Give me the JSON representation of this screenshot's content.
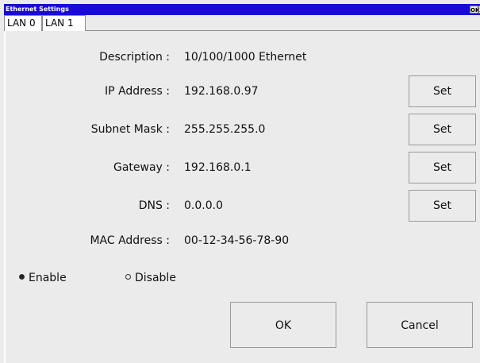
{
  "window": {
    "title": "Ethernet Settings",
    "ok_label": "OK",
    "close_label": "X"
  },
  "tabs": [
    {
      "label": "LAN 0",
      "selected": true
    },
    {
      "label": "LAN 1",
      "selected": false
    }
  ],
  "fields": {
    "description": {
      "label": "Description :",
      "value": "10/100/1000 Ethernet"
    },
    "ip": {
      "label": "IP Address :",
      "value": "192.168.0.97",
      "button": "Set"
    },
    "subnet": {
      "label": "Subnet Mask :",
      "value": "255.255.255.0",
      "button": "Set"
    },
    "gateway": {
      "label": "Gateway :",
      "value": "192.168.0.1",
      "button": "Set"
    },
    "dns": {
      "label": "DNS :",
      "value": "0.0.0.0",
      "button": "Set"
    },
    "mac": {
      "label": "MAC Address :",
      "value": "00-12-34-56-78-90"
    }
  },
  "mode": {
    "enable_label": "Enable",
    "disable_label": "Disable",
    "selected": "Enable"
  },
  "actions": {
    "ok_label": "OK",
    "cancel_label": "Cancel"
  },
  "colors": {
    "titlebar": "#1a0ad6",
    "background": "#ebebeb"
  }
}
